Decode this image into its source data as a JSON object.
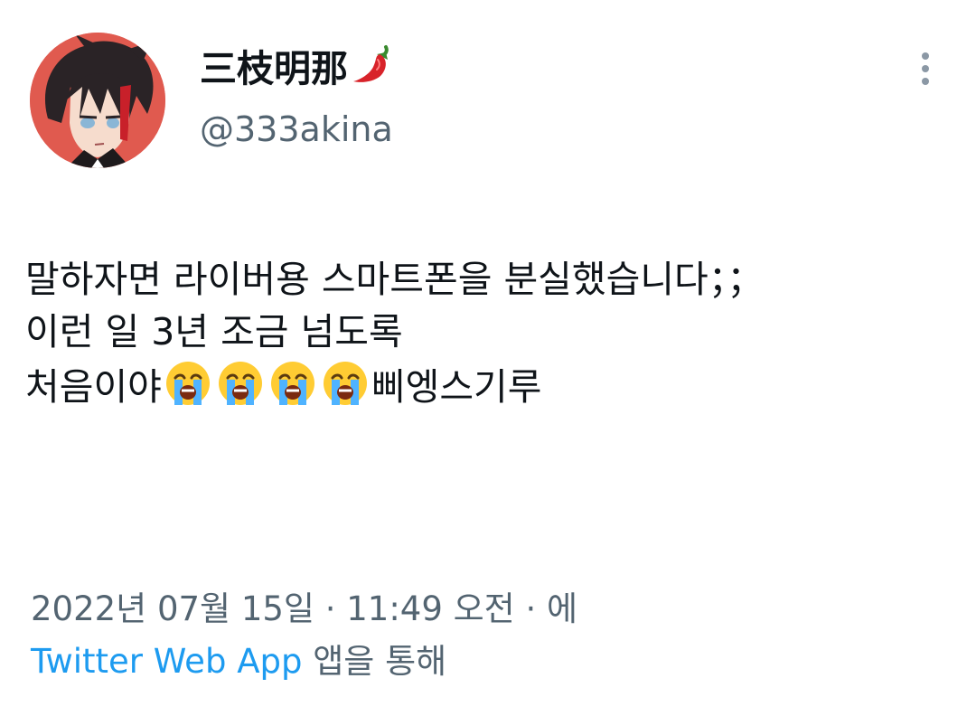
{
  "author": {
    "display_name": "三枝明那",
    "display_name_emoji": "chili-pepper-icon",
    "handle": "@333akina",
    "avatar": "anime-character-avatar"
  },
  "more_icon": "more-vertical-icon",
  "tweet": {
    "line1": "말하자면 라이버용 스마트폰을 분실했습니다；；",
    "line2": "이런 일 3년 조금 넘도록",
    "line3_before": "처음이야",
    "line3_emoji": [
      "loudly-crying-face-icon",
      "loudly-crying-face-icon",
      "loudly-crying-face-icon",
      "loudly-crying-face-icon"
    ],
    "line3_after": "삐엥스기루"
  },
  "meta": {
    "timestamp": "2022년 07월 15일 · 11:49 오전 · 에",
    "source_app": "Twitter Web App",
    "source_suffix": " 앱을 통해"
  },
  "colors": {
    "text_primary": "#0f1419",
    "text_secondary": "#536471",
    "link": "#1d9bf0",
    "avatar_bg": "#e05a4f"
  }
}
